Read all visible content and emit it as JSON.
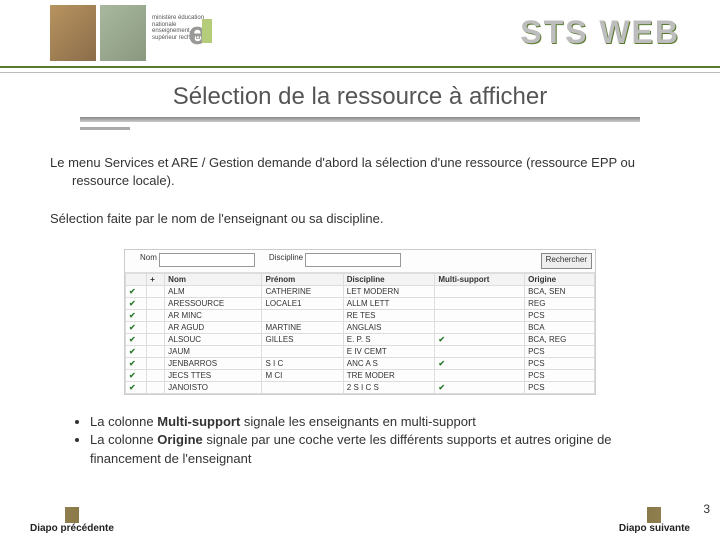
{
  "brand": "STS WEB",
  "logo_text": "ministère\néducation\nnationale\nenseignement\nsupérieur\nrecherche",
  "title": "Sélection de la ressource à afficher",
  "para1": "Le menu Services et ARE / Gestion demande d'abord la sélection d'une ressource (ressource EPP ou ressource locale).",
  "para2": "Sélection faite par le nom de l'enseignant ou sa discipline.",
  "search": {
    "nom_label": "Nom",
    "discipline_label": "Discipline",
    "button": "Rechercher"
  },
  "table": {
    "headers": [
      "",
      "+",
      "Nom",
      "Prénom",
      "Discipline",
      "Multi-support",
      "Origine"
    ],
    "rows": [
      [
        "✔",
        "",
        "ALM",
        "CATHERINE",
        "LET MODERN",
        "",
        "BCA, SEN"
      ],
      [
        "✔",
        "",
        "ARESSOURCE",
        "LOCALE1",
        "ALLM LETT",
        "",
        "REG"
      ],
      [
        "✔",
        "",
        "AR MINC",
        "",
        "RE TES",
        "",
        "PCS"
      ],
      [
        "✔",
        "",
        "AR AGUD",
        "MARTINE",
        "ANGLAIS",
        "",
        "BCA"
      ],
      [
        "✔",
        "",
        "ALSOUC",
        "GILLES",
        "E. P. S",
        "✔",
        "BCA, REG"
      ],
      [
        "✔",
        "",
        "JAUM",
        "",
        "E IV CEMT",
        "",
        "PCS"
      ],
      [
        "✔",
        "",
        "JENBARROS",
        "S I C",
        "ANC A S",
        "✔",
        "PCS"
      ],
      [
        "✔",
        "",
        "JECS TTES",
        "M CI",
        "TRE MODER",
        "",
        "PCS"
      ],
      [
        "✔",
        "",
        "JANOISTO",
        "",
        "2 S I C S",
        "✔",
        "PCS"
      ]
    ]
  },
  "bullets": {
    "b1_pre": "La colonne ",
    "b1_strong": "Multi-support",
    "b1_post": " signale les enseignants en multi-support",
    "b2_pre": "La colonne ",
    "b2_strong": "Origine",
    "b2_post": " signale par une coche verte les différents supports et autres origine de financement de l'enseignant"
  },
  "nav": {
    "prev": "Diapo précédente",
    "next": "Diapo suivante"
  },
  "page_number": "3"
}
